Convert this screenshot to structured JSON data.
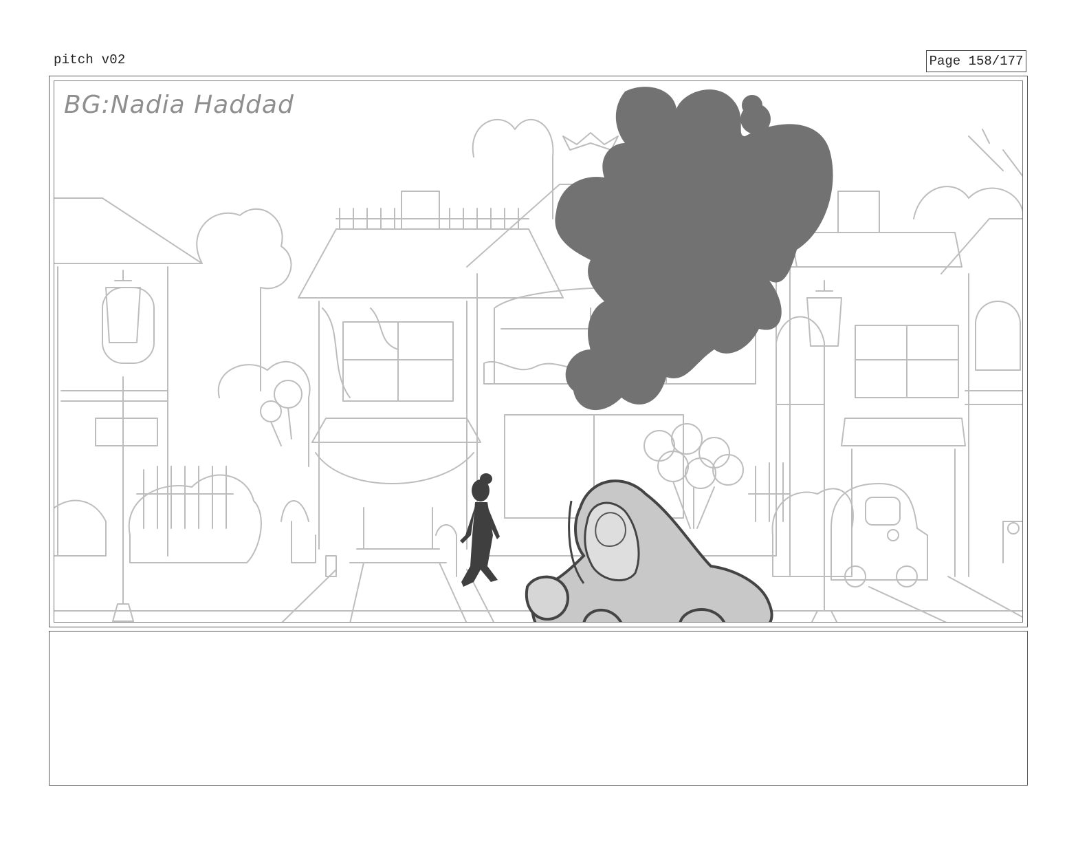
{
  "document": {
    "title": "pitch v02",
    "page_label": "Page 158/177"
  },
  "panel": {
    "bg_credit": "BG:Nadia Haddad",
    "sketch_colors": {
      "line": "#bdbdbd",
      "shadow_blob": "#727272",
      "car_fill": "#c8c8c8",
      "car_outline": "#444444",
      "figure": "#3f3f3f"
    }
  },
  "notes": {
    "text": ""
  }
}
